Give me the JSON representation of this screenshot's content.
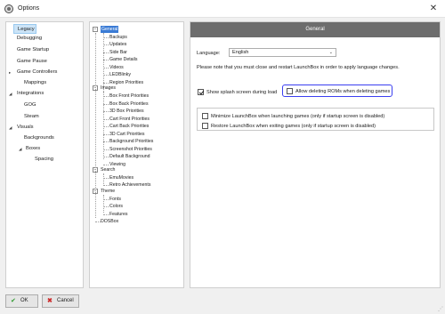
{
  "window": {
    "title": "Options",
    "close_glyph": "✕",
    "app_icon": "gear-icon"
  },
  "sidebar": {
    "items": [
      {
        "label": "Legacy",
        "selected": true,
        "arrow": ""
      },
      {
        "label": "Debugging",
        "arrow": ""
      },
      {
        "label": "Game Startup",
        "arrow": ""
      },
      {
        "label": "Game Pause",
        "arrow": ""
      },
      {
        "label": "Game Controllers",
        "arrow": "▸"
      },
      {
        "label": "Mappings",
        "arrow": ""
      },
      {
        "label": "Integrations",
        "arrow": "◢"
      },
      {
        "label": "GOG",
        "arrow": ""
      },
      {
        "label": "Steam",
        "arrow": ""
      },
      {
        "label": "Visuals",
        "arrow": "◢"
      },
      {
        "label": "Backgrounds",
        "arrow": ""
      },
      {
        "label": "Boxes",
        "arrow": "◢"
      },
      {
        "label": "Spacing",
        "arrow": ""
      }
    ]
  },
  "tree": {
    "nodes": [
      {
        "label": "General",
        "selected": true,
        "expanded": true
      },
      {
        "label": "Backups"
      },
      {
        "label": "Updates"
      },
      {
        "label": "Side Bar"
      },
      {
        "label": "Game Details"
      },
      {
        "label": "Videos"
      },
      {
        "label": "LEDBlinky"
      },
      {
        "label": "Region Priorities"
      },
      {
        "label": "Images",
        "expanded": true
      },
      {
        "label": "Box Front Priorities"
      },
      {
        "label": "Box Back Priorities"
      },
      {
        "label": "3D Box Priorities"
      },
      {
        "label": "Cart Front Priorities"
      },
      {
        "label": "Cart Back Priorities"
      },
      {
        "label": "3D Cart Priorities"
      },
      {
        "label": "Background Priorities"
      },
      {
        "label": "Screenshot Priorities"
      },
      {
        "label": "Default Background"
      },
      {
        "label": "Viewing"
      },
      {
        "label": "Search",
        "expanded": true
      },
      {
        "label": "EmuMovies"
      },
      {
        "label": "Retro Achievements"
      },
      {
        "label": "Theme",
        "expanded": true
      },
      {
        "label": "Fonts"
      },
      {
        "label": "Colors"
      },
      {
        "label": "Features"
      },
      {
        "label": "DOSBox"
      }
    ],
    "expander_glyph": "−"
  },
  "panel": {
    "header": "General",
    "language_label": "Language:",
    "language_value": "English",
    "dropdown_glyph": "⌄",
    "note": "Please note that you must close and restart LaunchBox in order to apply language changes.",
    "show_splash": {
      "label": "Show splash screen during load",
      "checked": true
    },
    "allow_delete_roms": {
      "label": "Allow deleting ROMs when deleting games",
      "checked": false
    },
    "minimize_on_launch": {
      "label": "Minimize LaunchBox when launching games (only if startup screen is disabled)",
      "checked": false
    },
    "restore_on_exit": {
      "label": "Restore LaunchBox when exiting games (only if startup screen is disabled)",
      "checked": false
    }
  },
  "buttons": {
    "ok_label": "OK",
    "ok_icon": "check-icon",
    "ok_glyph": "✔",
    "cancel_label": "Cancel",
    "cancel_icon": "cancel-icon",
    "cancel_glyph": "✖"
  },
  "colors": {
    "selection_blue": "#3a7bd5",
    "highlight_border": "#3b3ff0",
    "header_gray": "#6d6d6d"
  }
}
